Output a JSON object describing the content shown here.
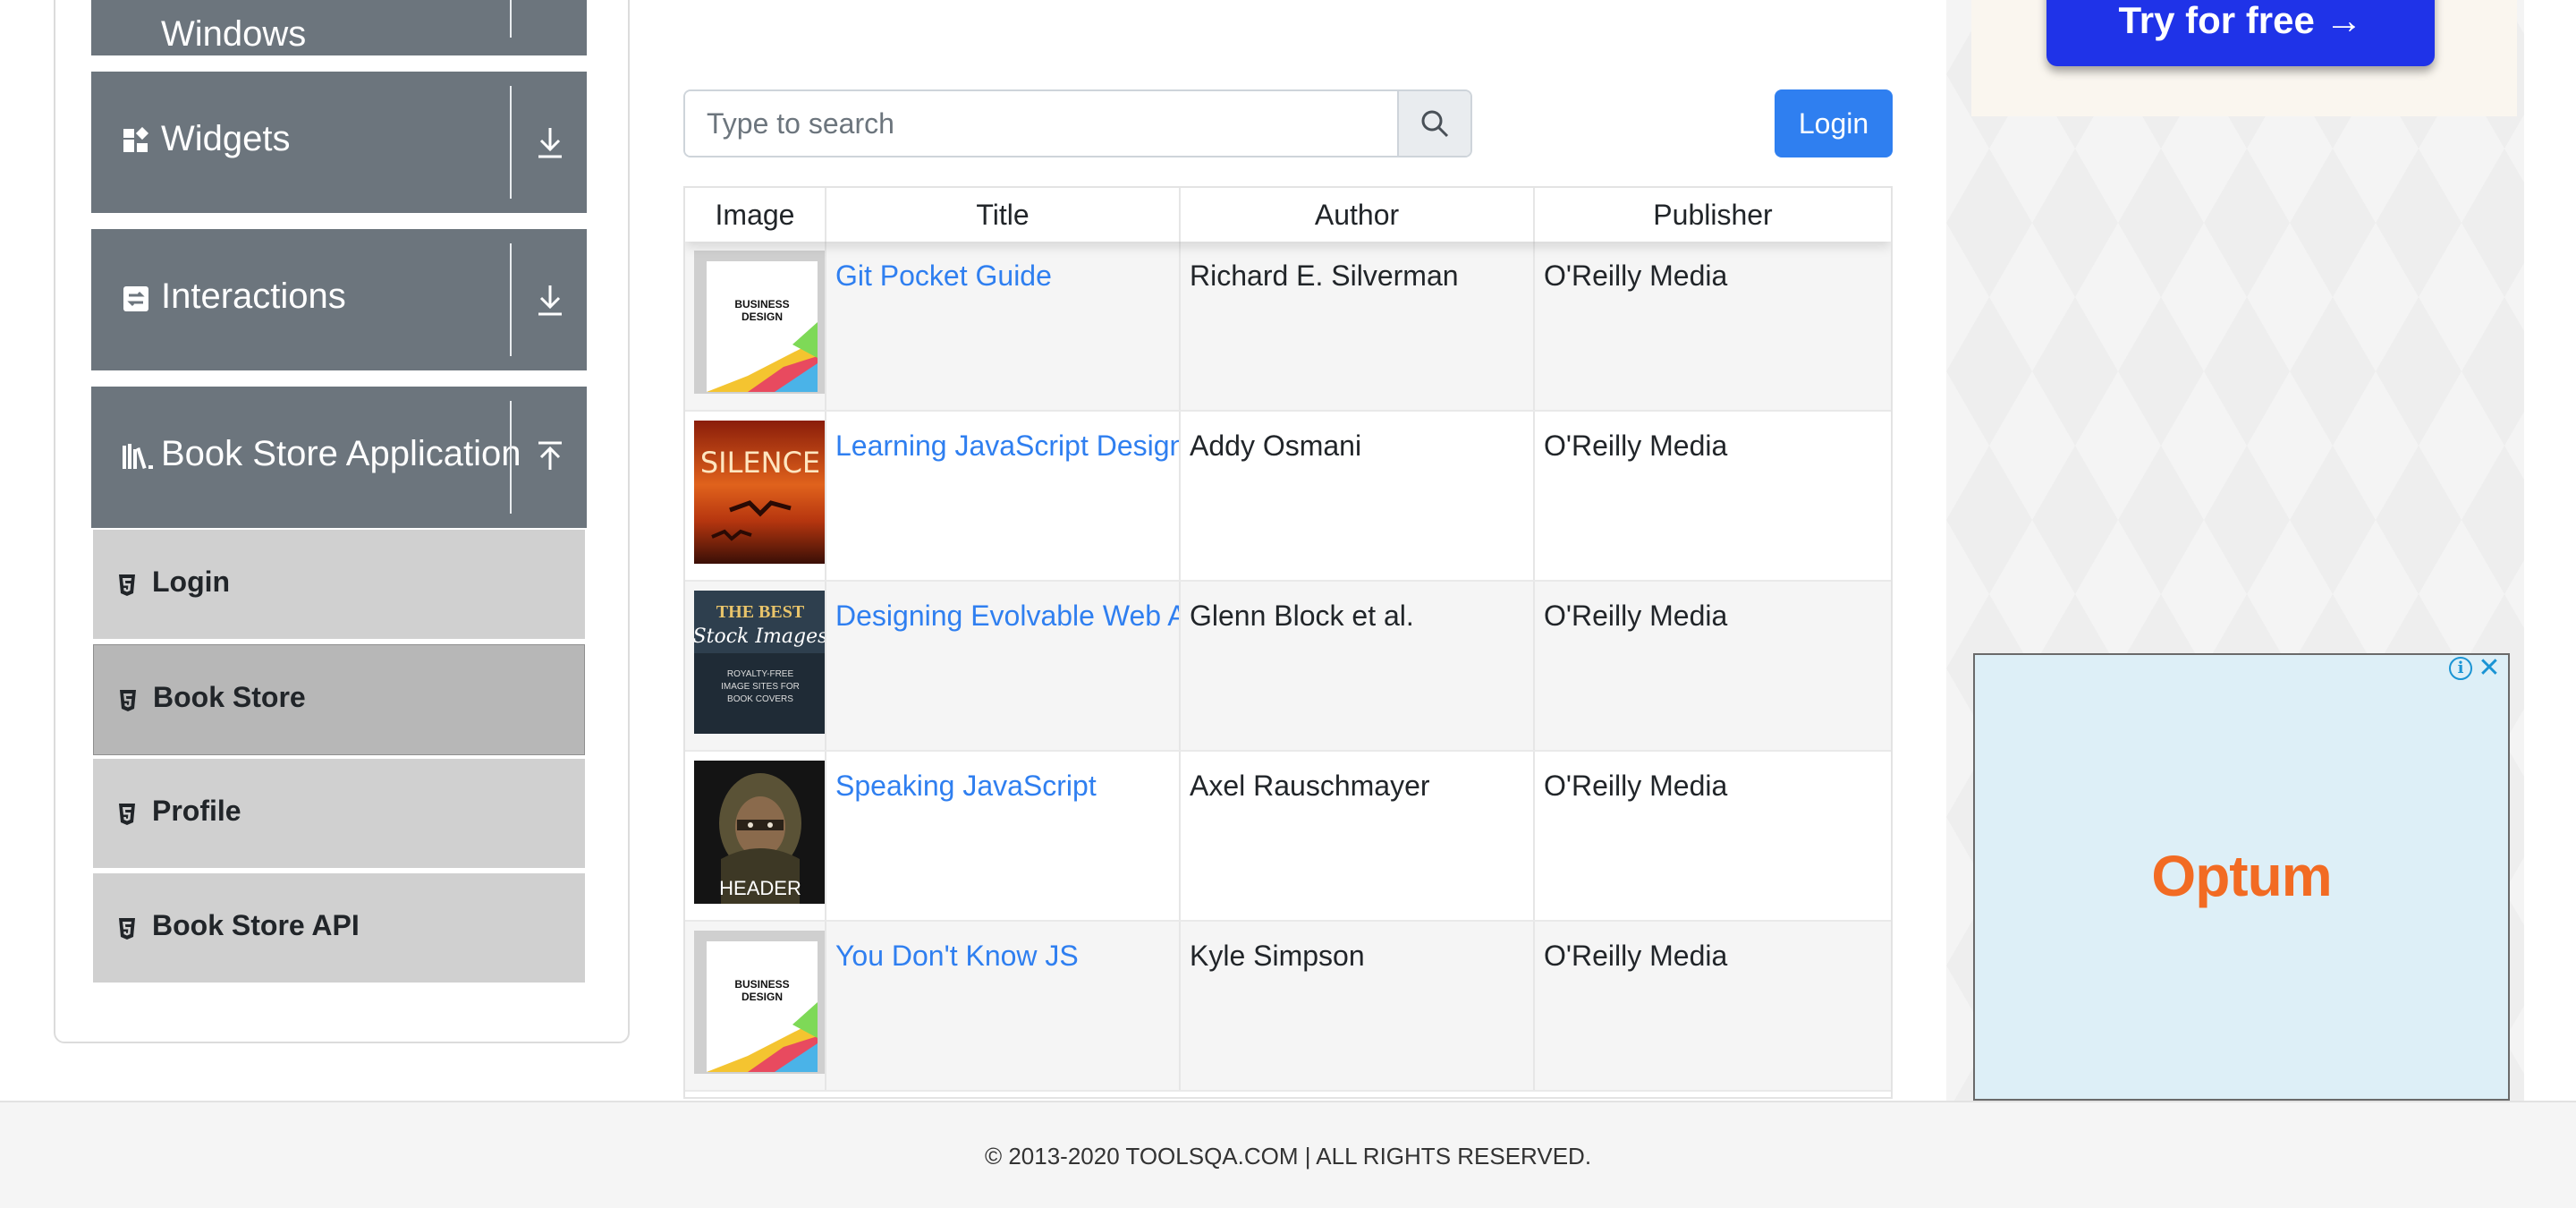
{
  "sidebar": {
    "groups": [
      {
        "label": "Windows",
        "icon": "window-icon",
        "state": "collapsed"
      },
      {
        "label": "Widgets",
        "icon": "widgets-icon",
        "state": "collapsed"
      },
      {
        "label": "Interactions",
        "icon": "interactions-icon",
        "state": "collapsed"
      },
      {
        "label": "Book Store Application",
        "icon": "books-icon",
        "state": "expanded"
      }
    ],
    "book_store_items": [
      {
        "label": "Login",
        "active": false
      },
      {
        "label": "Book Store",
        "active": true
      },
      {
        "label": "Profile",
        "active": false
      },
      {
        "label": "Book Store API",
        "active": false
      }
    ]
  },
  "search": {
    "placeholder": "Type to search",
    "value": ""
  },
  "login_button": {
    "label": "Login"
  },
  "table": {
    "headers": [
      "Image",
      "Title",
      "Author",
      "Publisher"
    ],
    "rows": [
      {
        "cover": "business-design-cover",
        "title": "Git Pocket Guide",
        "author": "Richard E. Silverman",
        "publisher": "O'Reilly Media"
      },
      {
        "cover": "silence-cover",
        "title": "Learning JavaScript Design Patterns",
        "author": "Addy Osmani",
        "publisher": "O'Reilly Media"
      },
      {
        "cover": "stock-images-cover",
        "title": "Designing Evolvable Web APIs with ASP.NET",
        "author": "Glenn Block et al.",
        "publisher": "O'Reilly Media"
      },
      {
        "cover": "header-cover",
        "title": "Speaking JavaScript",
        "author": "Axel Rauschmayer",
        "publisher": "O'Reilly Media"
      },
      {
        "cover": "business-design-cover",
        "title": "You Don't Know JS",
        "author": "Kyle Simpson",
        "publisher": "O'Reilly Media"
      }
    ]
  },
  "covers": {
    "business_design": {
      "line1": "BUSINESS",
      "line2": "DESIGN"
    },
    "silence": {
      "title": "SILENCE"
    },
    "stock_images": {
      "line1": "THE BEST",
      "line2": "Stock Images",
      "line3": "ROYALTY-FREE",
      "line4": "IMAGE SITES FOR",
      "line5": "BOOK COVERS"
    },
    "header": {
      "title": "HEADER"
    }
  },
  "ads": {
    "try_button": "Try for free →",
    "brand": "Optum",
    "info_glyph": "i",
    "close_glyph": "✕"
  },
  "footer": {
    "text": "© 2013-2020 TOOLSQA.COM | ALL RIGHTS RESERVED."
  },
  "colors": {
    "accent": "#2f7ff0",
    "sidebar_header": "#6c757d",
    "sidebar_item": "#d0d0d0",
    "sidebar_item_active": "#b7b7b7",
    "ad_brand": "#f26b23"
  }
}
